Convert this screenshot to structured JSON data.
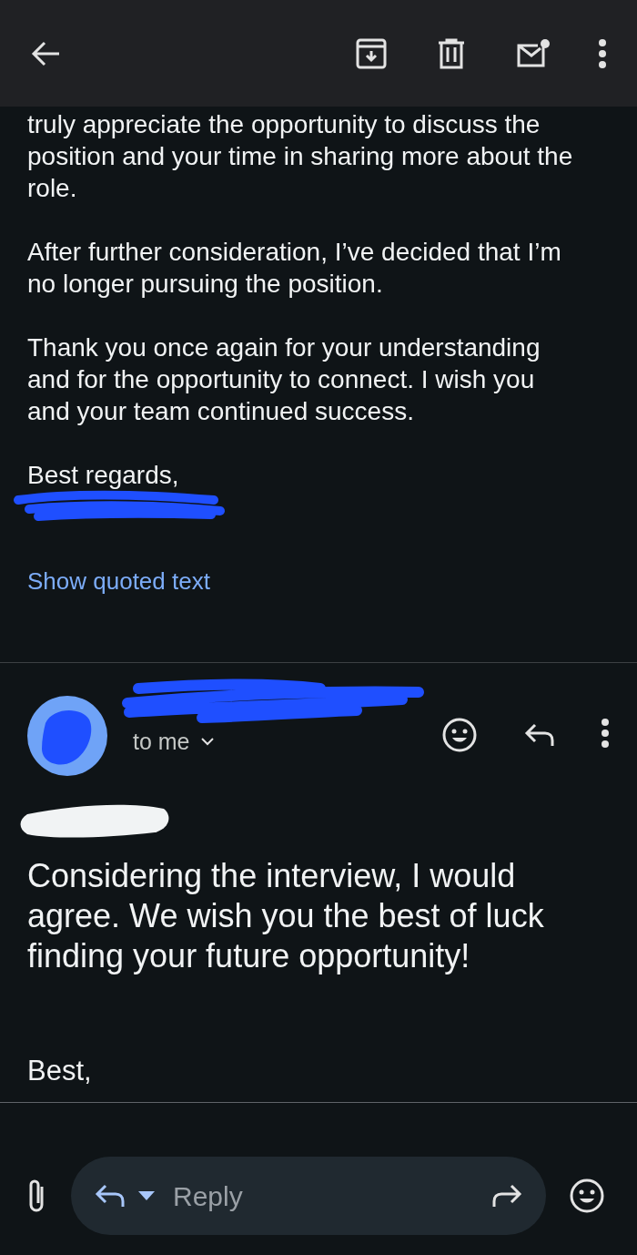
{
  "quoted_message": {
    "paragraphs": [
      "truly appreciate the opportunity to discuss the position and your time in sharing more about the role.",
      "After further consideration, I’ve decided that I’m no longer pursuing the position.",
      "Thank you once again for your understanding and for the opportunity to connect. I wish you and your team continued success.",
      "Best regards,"
    ],
    "show_quoted_text": "Show quoted text"
  },
  "reply_message": {
    "recipient": "to me",
    "body": "Considering the interview, I would agree. We wish you the best of luck finding your future opportunity!",
    "closing": "Best,"
  },
  "reply_bar": {
    "placeholder": "Reply"
  }
}
